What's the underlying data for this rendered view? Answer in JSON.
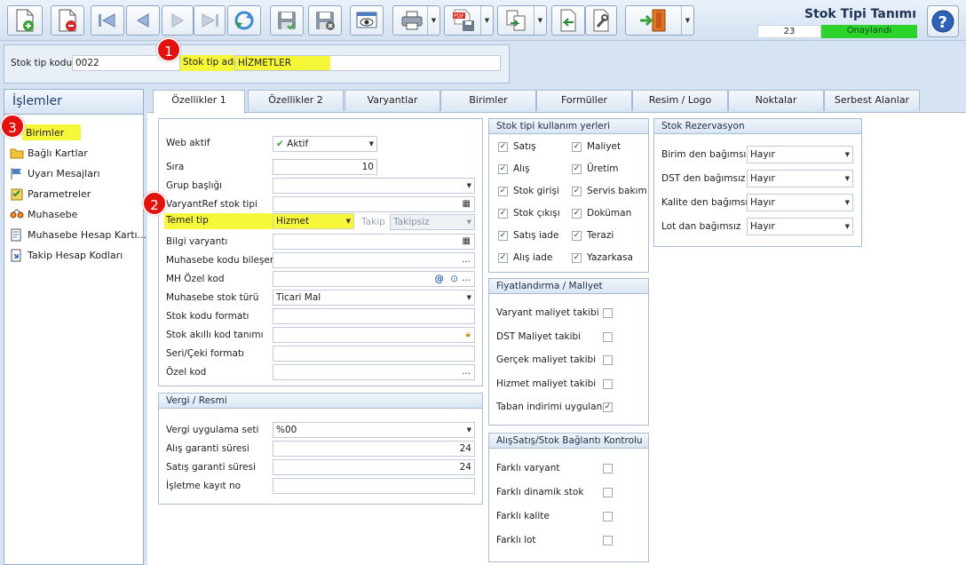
{
  "window": {
    "title": "Stok Tipi Tanımı",
    "count": "23",
    "status": "Onaylandı"
  },
  "header": {
    "code_label": "Stok tip kodu",
    "code_value": "0022",
    "name_label": "Stok tip adı",
    "name_value": "HİZMETLER"
  },
  "badges": {
    "one": "1",
    "two": "2",
    "three": "3"
  },
  "sidebar": {
    "title": "İşlemler",
    "items": [
      "Birimler",
      "Bağlı Kartlar",
      "Uyarı Mesajları",
      "Parametreler",
      "Muhasebe",
      "Muhasebe Hesap Kartı...",
      "Takip Hesap Kodları"
    ]
  },
  "tabs": [
    "Özellikler 1",
    "Özellikler 2",
    "Varyantlar",
    "Birimler",
    "Formüller",
    "Resim / Logo",
    "Noktalar",
    "Serbest Alanlar"
  ],
  "general": {
    "web_label": "Web aktif",
    "web_value": "Aktif",
    "sira_label": "Sıra",
    "sira_value": "10",
    "grup_label": "Grup başlığı",
    "varyantref_label": "VaryantRef stok tipi",
    "temel_label": "Temel tip",
    "temel_value": "Hizmet",
    "takip_label": "Takip",
    "takip_value": "Takipsiz",
    "bilgi_label": "Bilgi varyantı",
    "muh_bilesen_label": "Muhasebe kodu bileşeni",
    "mh_ozel_label": "MH Özel kod",
    "muh_tur_label": "Muhasebe stok türü",
    "muh_tur_value": "Ticari Mal",
    "kod_format_label": "Stok kodu formatı",
    "akilli_label": "Stok akıllı kod tanımı",
    "seri_label": "Seri/Çeki formatı",
    "ozel_label": "Özel kod"
  },
  "vergi": {
    "title": "Vergi / Resmi",
    "set_label": "Vergi uygulama seti",
    "set_value": "%00",
    "alis_label": "Alış garanti süresi",
    "alis_value": "24",
    "satis_label": "Satış garanti süresi",
    "satis_value": "24",
    "isletme_label": "İşletme kayıt no"
  },
  "kullanim": {
    "title": "Stok tipi kullanım yerleri",
    "left": [
      "Satış",
      "Alış",
      "Stok girişi",
      "Stok çıkışı",
      "Satış iade",
      "Alış iade"
    ],
    "right": [
      "Maliyet",
      "Üretim",
      "Servis bakım",
      "Doküman",
      "Terazi",
      "Yazarkasa"
    ]
  },
  "fiyat": {
    "title": "Fiyatlandırma / Maliyet",
    "items": [
      "Varyant maliyet takibi",
      "DST Maliyet takibi",
      "Gerçek maliyet takibi",
      "Hizmet maliyet takibi",
      "Taban indirimi uygulanır"
    ],
    "checked": [
      false,
      false,
      false,
      false,
      true
    ]
  },
  "baglanti": {
    "title": "AlışSatış/Stok Bağlantı Kontrolu",
    "items": [
      "Farklı varyant",
      "Farklı dinamik stok",
      "Farklı kalite",
      "Farklı lot"
    ]
  },
  "rezerv": {
    "title": "Stok Rezervasyon",
    "items": [
      {
        "label": "Birim den bağımsız",
        "value": "Hayır"
      },
      {
        "label": "DST den bağımsız",
        "value": "Hayır"
      },
      {
        "label": "Kalite den bağımsız",
        "value": "Hayır"
      },
      {
        "label": "Lot dan bağımsız",
        "value": "Hayır"
      }
    ]
  },
  "icons": {
    "new": "new-document-icon",
    "delete": "delete-document-icon",
    "first": "first-record-icon",
    "prev": "previous-record-icon",
    "next": "next-record-icon",
    "last": "last-record-icon",
    "refresh": "refresh-icon",
    "save": "save-icon",
    "save_close": "save-close-icon",
    "preview": "preview-icon",
    "print": "print-icon",
    "pdf": "pdf-export-icon",
    "export": "export-icon",
    "import": "import-icon",
    "tools": "tools-icon",
    "exit": "exit-door-icon",
    "help": "help-icon"
  },
  "colors": {
    "status_bg": "#2bd32b",
    "highlight": "#f7f73a",
    "badge": "#e2120e"
  }
}
